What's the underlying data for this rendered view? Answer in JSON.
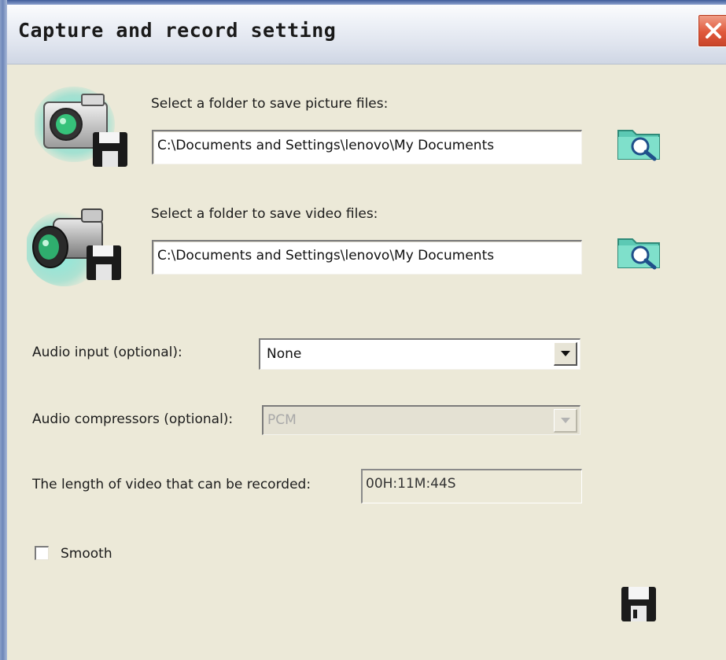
{
  "window": {
    "title": "Capture and record setting",
    "close_icon": "close-icon"
  },
  "picture": {
    "label": "Select a folder to save picture files:",
    "path": "C:\\Documents and Settings\\lenovo\\My Documents",
    "icon": "camera-save-icon",
    "browse_icon": "folder-search-icon"
  },
  "video": {
    "label": "Select a folder to save video files:",
    "path": "C:\\Documents and Settings\\lenovo\\My Documents",
    "icon": "camcorder-save-icon",
    "browse_icon": "folder-search-icon"
  },
  "audio_input": {
    "label": "Audio input (optional):",
    "value": "None"
  },
  "audio_compressor": {
    "label": "Audio compressors (optional):",
    "value": "PCM",
    "enabled": false
  },
  "record_length": {
    "label": "The length of video that can be recorded:",
    "value": "00H:11M:44S"
  },
  "smooth": {
    "label": "Smooth",
    "checked": false
  },
  "save_icon": "floppy-save-icon",
  "colors": {
    "dialog_bg": "#ece9d8",
    "close_red": "#e0583b",
    "accent_teal": "#4fd6c8"
  }
}
